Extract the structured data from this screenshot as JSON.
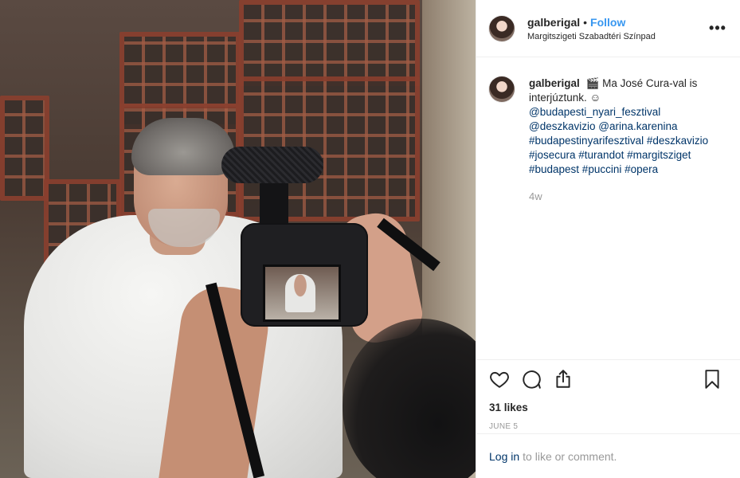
{
  "post": {
    "username": "galberigal",
    "follow_separator": "•",
    "follow_label": "Follow",
    "location": "Margitszigeti Szabadtéri Színpad",
    "more_label": "•••"
  },
  "caption": {
    "username": "galberigal",
    "text": "🎬 Ma José Cura-val is interjúztunk. ☺",
    "tags_line1": "@budapesti_nyari_fesztival",
    "tags_line2": "@deszkavizio @arina.karenina",
    "tags_line3": "#budapestinyarifesztival #deszkavizio",
    "tags_line4": "#josecura #turandot #margitsziget",
    "tags_line5": "#budapest #puccini #opera",
    "age": "4w"
  },
  "actions": {
    "icons": [
      "heart-icon",
      "comment-icon",
      "share-icon",
      "bookmark-icon"
    ],
    "likes": "31 likes",
    "date": "JUNE 5"
  },
  "footer": {
    "login_link": "Log in",
    "login_text": "to like or comment."
  },
  "colors": {
    "accent": "#3897f0",
    "link": "#003569",
    "muted": "#999999",
    "text": "#262626"
  }
}
